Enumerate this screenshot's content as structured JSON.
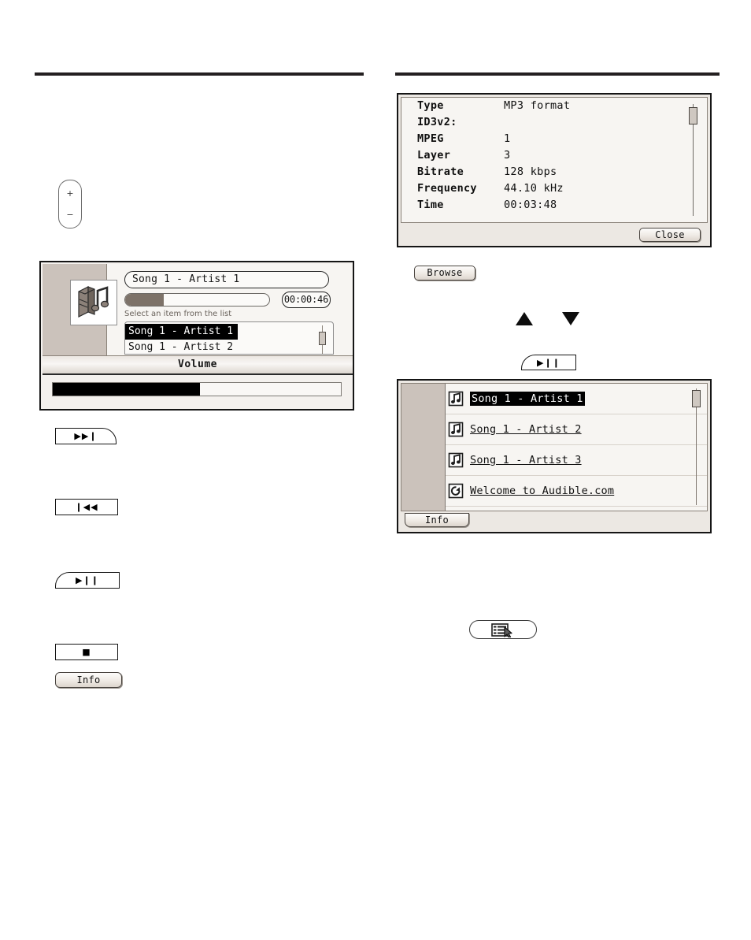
{
  "rules": {
    "left": "",
    "right": ""
  },
  "rocker": {
    "name": "volume-rocker",
    "plus": "+",
    "minus": "−"
  },
  "player": {
    "album_art_icon": "audiobook-note-icon",
    "now_playing": "Song 1 - Artist 1",
    "elapsed_time": "00:00:46",
    "progress_percent": 27,
    "prompt": "Select an item from the list",
    "list_items": [
      {
        "label": "Song 1 - Artist 1",
        "selected": true
      },
      {
        "label": "Song 1 - Artist 2",
        "selected": false
      }
    ],
    "volume_title": "Volume",
    "volume_percent": 51
  },
  "info_dialog": {
    "rows": [
      {
        "key": "Type",
        "value": "MP3 format"
      },
      {
        "key": "ID3v2:",
        "value": ""
      },
      {
        "key": "MPEG",
        "value": "1"
      },
      {
        "key": "Layer",
        "value": "3"
      },
      {
        "key": "Bitrate",
        "value": "128  kbps"
      },
      {
        "key": "Frequency",
        "value": "44.10  kHz"
      },
      {
        "key": "Time",
        "value": "00:03:48"
      }
    ],
    "close_label": "Close"
  },
  "buttons": {
    "browse": "Browse",
    "info_left": "Info",
    "next": "▶▶❙",
    "prev": "❙◀◀",
    "play_pause": "▶❙❙",
    "stop": "■",
    "play_pause_2": "▶❙❙",
    "up_arrow": "up-triangle",
    "down_arrow": "down-triangle",
    "menu_icon": "list-cursor-icon"
  },
  "song_list": {
    "items": [
      {
        "label": "Song 1 - Artist 1",
        "icon": "music-note-file-icon",
        "selected": true
      },
      {
        "label": "Song 1 - Artist 2",
        "icon": "music-note-file-icon",
        "selected": false
      },
      {
        "label": "Song 1 - Artist 3",
        "icon": "music-note-file-icon",
        "selected": false
      },
      {
        "label": "Welcome to Audible.com",
        "icon": "circular-arrow-icon",
        "selected": false
      }
    ],
    "info_label": "Info"
  },
  "colors": {
    "sidebar": "#cbc2bb",
    "window_border": "#151515",
    "panel": "#f7f5f2",
    "progress_fill": "#7d7268",
    "volume_fill": "#000000",
    "selection": "#000000"
  }
}
